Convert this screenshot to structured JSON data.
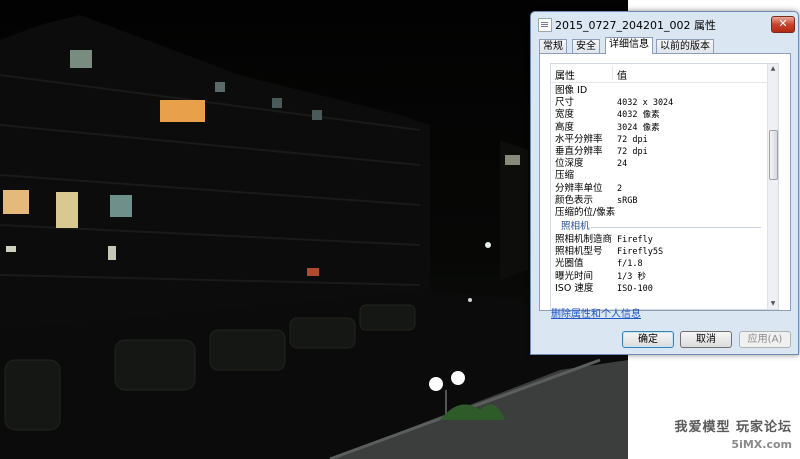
{
  "window": {
    "title": "2015_0727_204201_002 属性",
    "close_label": "✕"
  },
  "tabs": [
    {
      "label": "常规",
      "active": false
    },
    {
      "label": "安全",
      "active": false
    },
    {
      "label": "详细信息",
      "active": true
    },
    {
      "label": "以前的版本",
      "active": false
    }
  ],
  "details": {
    "header_name": "属性",
    "header_value": "值",
    "rows": [
      {
        "name": "图像 ID",
        "value": ""
      },
      {
        "name": "尺寸",
        "value": "4032 x 3024"
      },
      {
        "name": "宽度",
        "value": "4032 像素"
      },
      {
        "name": "高度",
        "value": "3024 像素"
      },
      {
        "name": "水平分辨率",
        "value": "72 dpi"
      },
      {
        "name": "垂直分辨率",
        "value": "72 dpi"
      },
      {
        "name": "位深度",
        "value": "24"
      },
      {
        "name": "压缩",
        "value": ""
      },
      {
        "name": "分辨率单位",
        "value": "2"
      },
      {
        "name": "颜色表示",
        "value": "sRGB"
      },
      {
        "name": "压缩的位/像素",
        "value": ""
      },
      {
        "name": "照相机",
        "value": "",
        "section": true
      },
      {
        "name": "照相机制造商",
        "value": "Firefly"
      },
      {
        "name": "照相机型号",
        "value": "Firefly5S"
      },
      {
        "name": "光圈值",
        "value": "f/1.8"
      },
      {
        "name": "曝光时间",
        "value": "1/3 秒"
      },
      {
        "name": "ISO 速度",
        "value": "ISO-100"
      }
    ]
  },
  "remove_link": "删除属性和个人信息",
  "buttons": {
    "ok": "确定",
    "cancel": "取消",
    "apply": "应用(A)"
  },
  "watermark": {
    "line1": "我爱模型 玩家论坛",
    "line2": "5iMX.com"
  },
  "colors": {
    "dialog_bg": "#dbe6f3",
    "link": "#1e55c8",
    "section": "#2a4fa0"
  }
}
